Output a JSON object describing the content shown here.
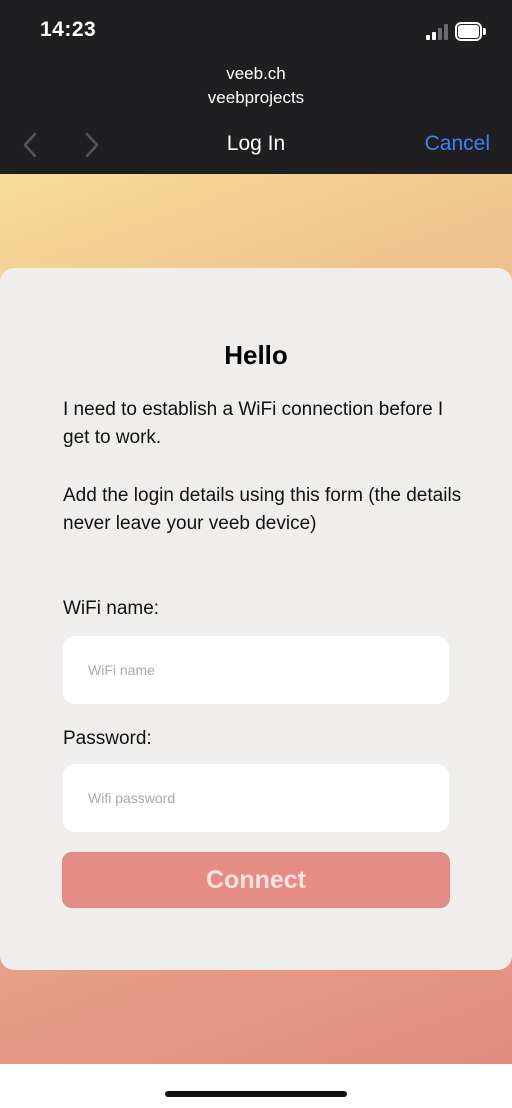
{
  "status_bar": {
    "time": "14:23"
  },
  "browser": {
    "domain": "veeb.ch",
    "subdomain": "veebprojects",
    "title": "Log In",
    "cancel_label": "Cancel",
    "accent_color": "#3d82f6"
  },
  "card": {
    "title": "Hello",
    "paragraph1": "I need to establish a WiFi connection before I get to work.",
    "paragraph2": "Add the login details using this form (the details never leave your veeb device)",
    "wifi_label": "WiFi name:",
    "wifi_placeholder": "WiFi name",
    "wifi_value": "",
    "password_label": "Password:",
    "password_placeholder": "Wifi password",
    "password_value": "",
    "connect_label": "Connect",
    "connect_color": "#e58d85"
  }
}
